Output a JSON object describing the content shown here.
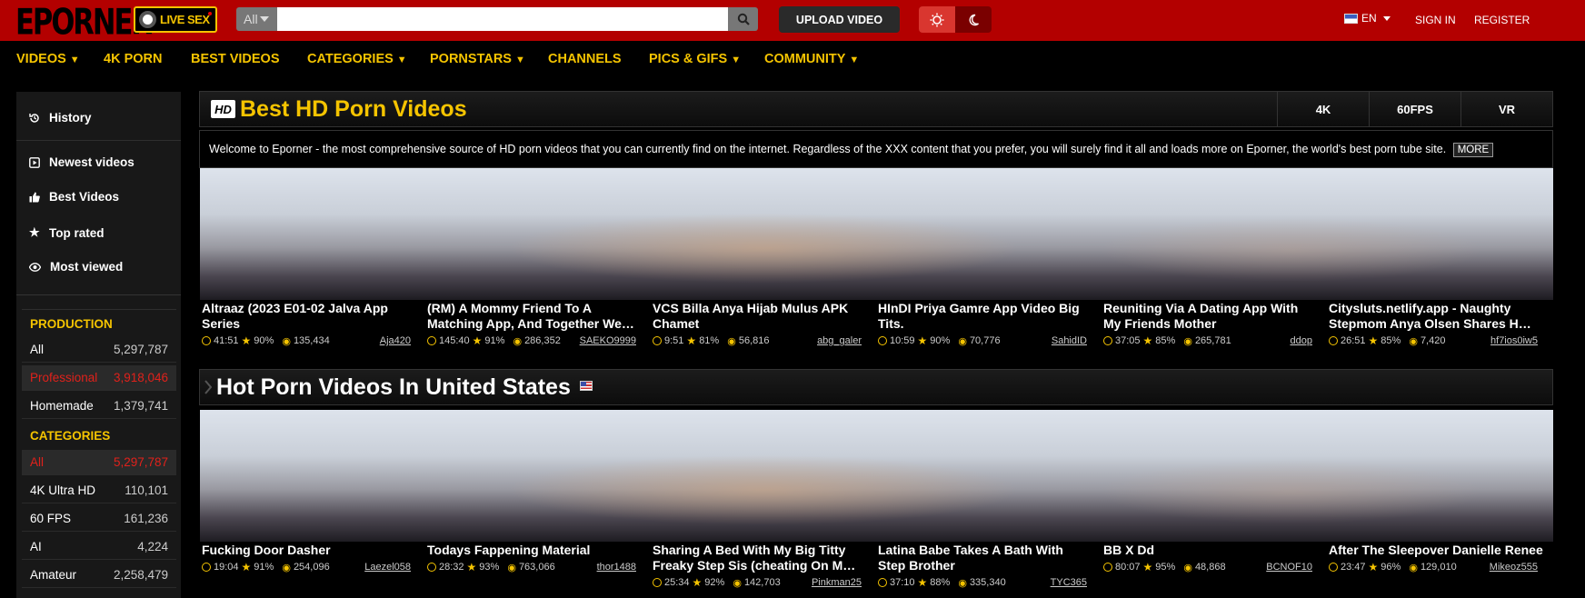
{
  "brand": {
    "logo": "EPORNER",
    "live_sex": "LIVE SEX"
  },
  "search": {
    "scope": "All",
    "placeholder": ""
  },
  "header": {
    "upload": "UPLOAD VIDEO",
    "lang": "EN",
    "sign_in": "SIGN IN",
    "register": "REGISTER"
  },
  "colors": {
    "topbar": "#b30000",
    "accent": "#f5c400",
    "highlight_red": "#e0211b"
  },
  "nav": [
    {
      "label": "VIDEOS",
      "dropdown": true
    },
    {
      "label": "4K PORN",
      "dropdown": false
    },
    {
      "label": "BEST VIDEOS",
      "dropdown": false
    },
    {
      "label": "CATEGORIES",
      "dropdown": true
    },
    {
      "label": "PORNSTARS",
      "dropdown": true
    },
    {
      "label": "CHANNELS",
      "dropdown": false
    },
    {
      "label": "PICS & GIFS",
      "dropdown": true
    },
    {
      "label": "COMMUNITY",
      "dropdown": true
    }
  ],
  "sidebar": {
    "menu": [
      {
        "label": "History",
        "icon": "history-icon"
      },
      {
        "label": "Newest videos",
        "icon": "play-icon"
      },
      {
        "label": "Best Videos",
        "icon": "thumbs-up-icon"
      },
      {
        "label": "Top rated",
        "icon": "star-icon"
      },
      {
        "label": "Most viewed",
        "icon": "eye-icon"
      }
    ],
    "production_title": "PRODUCTION",
    "production": [
      {
        "label": "All",
        "count": "5,297,787",
        "active": false
      },
      {
        "label": "Professional",
        "count": "3,918,046",
        "active": true
      },
      {
        "label": "Homemade",
        "count": "1,379,741",
        "active": false
      }
    ],
    "categories_title": "CATEGORIES",
    "categories": [
      {
        "label": "All",
        "count": "5,297,787",
        "active": true
      },
      {
        "label": "4K Ultra HD",
        "count": "110,101",
        "active": false
      },
      {
        "label": "60 FPS",
        "count": "161,236",
        "active": false
      },
      {
        "label": "AI",
        "count": "4,224",
        "active": false
      },
      {
        "label": "Amateur",
        "count": "2,258,479",
        "active": false
      }
    ]
  },
  "best": {
    "badge": "HD",
    "title": "Best HD Porn Videos",
    "filters": [
      "4K",
      "60FPS",
      "VR"
    ],
    "intro": "Welcome to Eporner - the most comprehensive source of HD porn videos that you can currently find on the internet. Regardless of the XXX content that you prefer, you will surely find it all and loads more on Eporner, the world's best porn tube site.",
    "more": "MORE",
    "videos": [
      {
        "title": "Altraaz (2023 E01-02 Jalva App Series",
        "duration": "41:51",
        "rating": "90%",
        "views": "135,434",
        "user": "Aja420"
      },
      {
        "title": "(RM) A Mommy Friend To A Matching App, And Together We…",
        "duration": "145:40",
        "rating": "91%",
        "views": "286,352",
        "user": "SAEKO9999"
      },
      {
        "title": "VCS Billa Anya Hijab Mulus APK Chamet",
        "duration": "9:51",
        "rating": "81%",
        "views": "56,816",
        "user": "abg_galer"
      },
      {
        "title": "HInDI Priya Gamre App Video Big Tits.",
        "duration": "10:59",
        "rating": "90%",
        "views": "70,776",
        "user": "SahidID"
      },
      {
        "title": "Reuniting Via A Dating App With My Friends Mother",
        "duration": "37:05",
        "rating": "85%",
        "views": "265,781",
        "user": "ddop"
      },
      {
        "title": "Citysluts.netlify.app - Naughty Stepmom Anya Olsen Shares H…",
        "duration": "26:51",
        "rating": "85%",
        "views": "7,420",
        "user": "hf7ios0iw5"
      }
    ]
  },
  "hot": {
    "title": "Hot Porn Videos In United States",
    "videos": [
      {
        "title": "Fucking Door Dasher",
        "duration": "19:04",
        "rating": "91%",
        "views": "254,096",
        "user": "Laezel058"
      },
      {
        "title": "Todays Fappening Material",
        "duration": "28:32",
        "rating": "93%",
        "views": "763,066",
        "user": "thor1488"
      },
      {
        "title": "Sharing A Bed With My Big Titty Freaky Step Sis (cheating On M…",
        "duration": "25:34",
        "rating": "92%",
        "views": "142,703",
        "user": "Pinkman25"
      },
      {
        "title": "Latina Babe Takes A Bath With Step Brother",
        "duration": "37:10",
        "rating": "88%",
        "views": "335,340",
        "user": "TYC365"
      },
      {
        "title": "BB X Dd",
        "duration": "80:07",
        "rating": "95%",
        "views": "48,868",
        "user": "BCNOF10"
      },
      {
        "title": "After The Sleepover Danielle Renee",
        "duration": "23:47",
        "rating": "96%",
        "views": "129,010",
        "user": "Mikeoz555"
      }
    ]
  }
}
